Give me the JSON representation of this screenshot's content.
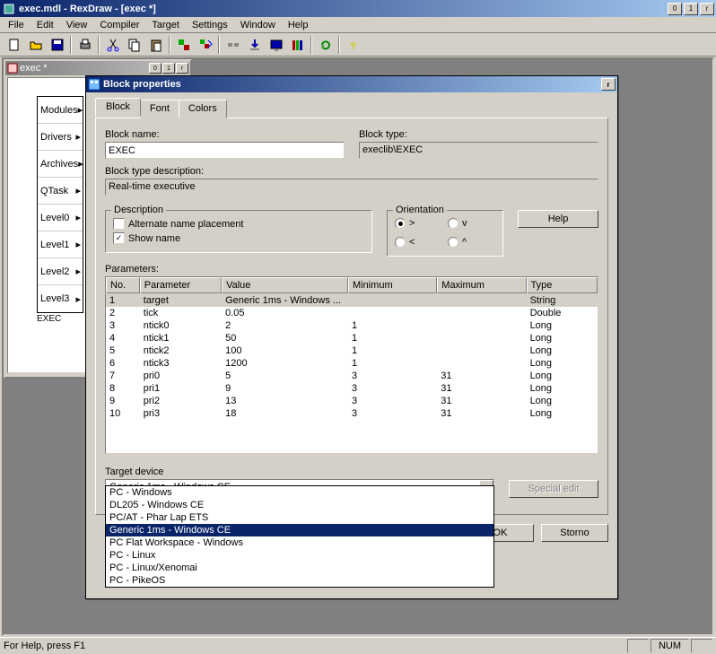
{
  "titlebar": {
    "title": "exec.mdl - RexDraw - [exec *]"
  },
  "menus": [
    "File",
    "Edit",
    "View",
    "Compiler",
    "Target",
    "Settings",
    "Window",
    "Help"
  ],
  "child": {
    "title": "exec *",
    "ports": [
      "Modules",
      "Drivers",
      "Archives",
      "QTask",
      "Level0",
      "Level1",
      "Level2",
      "Level3"
    ],
    "block_label": "EXEC"
  },
  "dialog": {
    "title": "Block properties",
    "tabs": [
      "Block",
      "Font",
      "Colors"
    ],
    "labels": {
      "block_name": "Block name:",
      "block_type": "Block type:",
      "type_desc": "Block type description:",
      "desc_group": "Description",
      "alt_placement": "Alternate name placement",
      "show_name": "Show name",
      "orient_group": "Orientation",
      "help": "Help",
      "params": "Parameters:",
      "target_device": "Target device",
      "special_edit": "Special edit",
      "ok": "OK",
      "storno": "Storno"
    },
    "block_name": "EXEC",
    "block_type": "execlib\\EXEC",
    "type_desc": "Real-time executive",
    "show_name": true,
    "orient": {
      "o1": ">",
      "o2": "<",
      "o3": "v",
      "o4": "^"
    },
    "table_headers": [
      "No.",
      "Parameter",
      "Value",
      "Minimum",
      "Maximum",
      "Type"
    ],
    "params": [
      {
        "no": "1",
        "par": "target",
        "val": "Generic 1ms - Windows ...",
        "min": "",
        "max": "",
        "typ": "String",
        "sel": true
      },
      {
        "no": "2",
        "par": "tick",
        "val": "0.05",
        "min": "",
        "max": "",
        "typ": "Double"
      },
      {
        "no": "3",
        "par": "ntick0",
        "val": "2",
        "min": "1",
        "max": "",
        "typ": "Long"
      },
      {
        "no": "4",
        "par": "ntick1",
        "val": "50",
        "min": "1",
        "max": "",
        "typ": "Long"
      },
      {
        "no": "5",
        "par": "ntick2",
        "val": "100",
        "min": "1",
        "max": "",
        "typ": "Long"
      },
      {
        "no": "6",
        "par": "ntick3",
        "val": "1200",
        "min": "1",
        "max": "",
        "typ": "Long"
      },
      {
        "no": "7",
        "par": "pri0",
        "val": "5",
        "min": "3",
        "max": "31",
        "typ": "Long"
      },
      {
        "no": "8",
        "par": "pri1",
        "val": "9",
        "min": "3",
        "max": "31",
        "typ": "Long"
      },
      {
        "no": "9",
        "par": "pri2",
        "val": "13",
        "min": "3",
        "max": "31",
        "typ": "Long"
      },
      {
        "no": "10",
        "par": "pri3",
        "val": "18",
        "min": "3",
        "max": "31",
        "typ": "Long"
      }
    ],
    "target_selected": "Generic 1ms - Windows CE",
    "target_options": [
      "PC - Windows",
      "DL205 - Windows CE",
      "PC/AT - Phar Lap ETS",
      "Generic 1ms - Windows CE",
      "PC Flat Workspace - Windows",
      "PC - Linux",
      "PC - Linux/Xenomai",
      "PC - PikeOS"
    ]
  },
  "status": {
    "msg": "For Help, press F1",
    "num": "NUM"
  }
}
